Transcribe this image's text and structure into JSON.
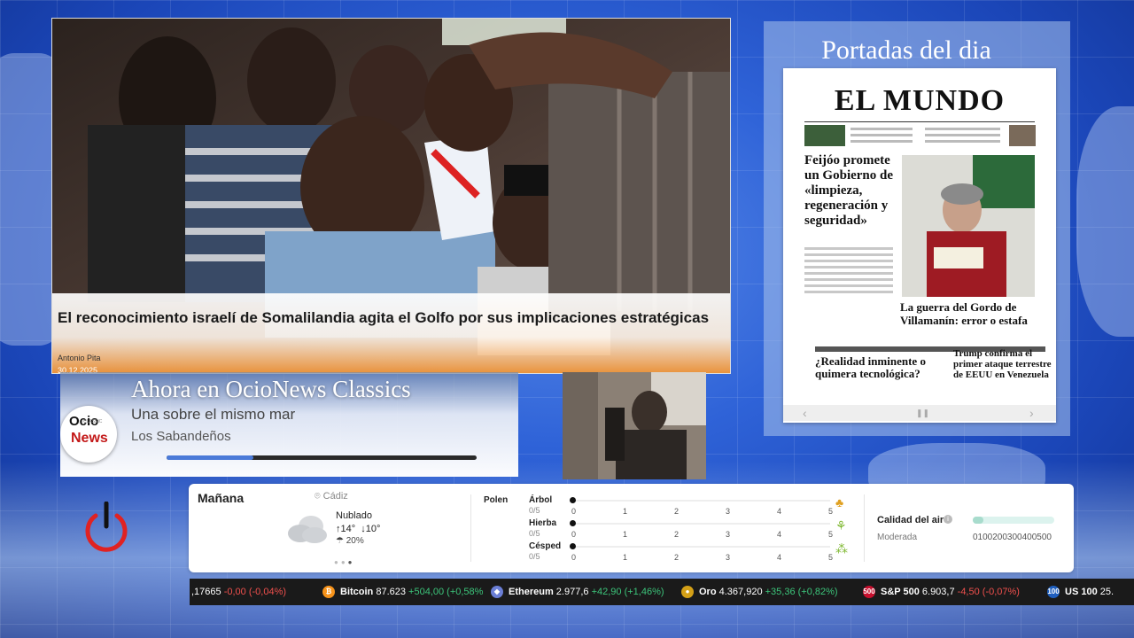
{
  "hero": {
    "title": "El reconocimiento israelí de Somalilandia agita el Golfo por sus implicaciones estratégicas",
    "author": "Antonio Pita",
    "date": "30.12.2025"
  },
  "classics": {
    "title": "Ahora en OcioNews Classics",
    "song": "Una sobre el mismo mar",
    "artist": "Los Sabandeños",
    "progress": 0.28
  },
  "logo": {
    "top": "Ocio",
    "sub": "CLASSIC",
    "bottom": "News"
  },
  "portadas": {
    "title": "Portadas del dia",
    "paper_name": "EL MUNDO",
    "headline_main": "Feijóo promete un Gobierno de «limpieza, regeneración y seguridad»",
    "headline_side": "La guerra del Gordo de Villamanín: error o estafa",
    "headline_bottom_left": "¿Realidad inminente o quimera tecnológica?",
    "headline_bottom_right": "Trump confirma el primer ataque terrestre de EEUU en Venezuela"
  },
  "weather": {
    "day": "Mañana",
    "location": "Cádiz",
    "condition": "Nublado",
    "temp_high": "14°",
    "temp_low": "10°",
    "rain": "20%",
    "polen_label": "Polen",
    "polen": [
      {
        "name": "Árbol",
        "score": "0/5"
      },
      {
        "name": "Hierba",
        "score": "0/5"
      },
      {
        "name": "Césped",
        "score": "0/5"
      }
    ],
    "scale": [
      "0",
      "1",
      "2",
      "3",
      "4",
      "5"
    ],
    "air_quality_label": "Calidad del aire",
    "air_quality_value": "Moderada",
    "air_scale": "0100200300400500"
  },
  "ticker": [
    {
      "name": "",
      "price": ",17665",
      "change": "-0,00 (-0,04%)",
      "dir": "down"
    },
    {
      "name": "Bitcoin",
      "price": "87.623",
      "change": "+504,00 (+0,58%",
      "dir": "up",
      "color": "#f7931a",
      "glyph": "₿"
    },
    {
      "name": "Ethereum",
      "price": "2.977,6",
      "change": "+42,90 (+1,46%)",
      "dir": "up",
      "color": "#6b7fd6",
      "glyph": "◆"
    },
    {
      "name": "Oro",
      "price": "4.367,920",
      "change": "+35,36 (+0,82%)",
      "dir": "up",
      "color": "#d4a017",
      "glyph": "●"
    },
    {
      "name": "S&P 500",
      "price": "6.903,7",
      "change": "-4,50 (-0,07%)",
      "dir": "down",
      "color": "#c8102e",
      "glyph": "500"
    },
    {
      "name": "US 100",
      "price": "25.",
      "change": "",
      "dir": "up",
      "color": "#1f5fbf",
      "glyph": "100"
    }
  ],
  "colors": {
    "accent": "#2f63d8",
    "up": "#3cc47a",
    "down": "#f0504d",
    "power": "#e02222"
  }
}
